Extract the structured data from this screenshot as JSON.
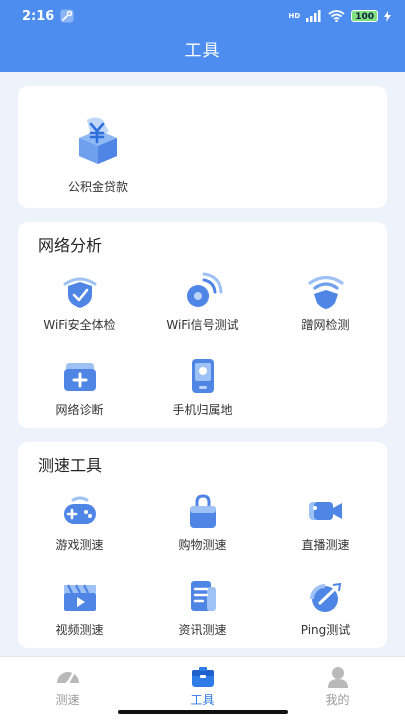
{
  "status_bar": {
    "time": "2:16",
    "network": "HD",
    "battery": "100"
  },
  "header": {
    "title": "工具"
  },
  "loan_card": {
    "item": {
      "label": "公积金贷款",
      "icon": "provident-fund-icon"
    }
  },
  "network_section": {
    "title": "网络分析",
    "items": [
      {
        "label": "WiFi安全体检",
        "icon": "wifi-shield-icon"
      },
      {
        "label": "WiFi信号测试",
        "icon": "wifi-signal-icon"
      },
      {
        "label": "蹭网检测",
        "icon": "wifi-freeloader-icon"
      },
      {
        "label": "网络诊断",
        "icon": "medical-kit-icon"
      },
      {
        "label": "手机归属地",
        "icon": "phone-location-icon"
      }
    ]
  },
  "speed_section": {
    "title": "测速工具",
    "items": [
      {
        "label": "游戏测速",
        "icon": "gamepad-icon"
      },
      {
        "label": "购物测速",
        "icon": "shopping-bag-icon"
      },
      {
        "label": "直播测速",
        "icon": "video-camera-icon"
      },
      {
        "label": "视频测速",
        "icon": "clapperboard-icon"
      },
      {
        "label": "资讯测速",
        "icon": "news-icon"
      },
      {
        "label": "Ping测试",
        "icon": "ping-gauge-icon"
      }
    ]
  },
  "bottom_nav": {
    "items": [
      {
        "label": "测速",
        "icon": "speedometer-icon",
        "active": false
      },
      {
        "label": "工具",
        "icon": "toolbox-icon",
        "active": true
      },
      {
        "label": "我的",
        "icon": "user-icon",
        "active": false
      }
    ]
  },
  "colors": {
    "brand": "#4e8df0",
    "active": "#2f7be8",
    "inactive": "#9a9a9a",
    "page_bg": "#eef3fb"
  }
}
